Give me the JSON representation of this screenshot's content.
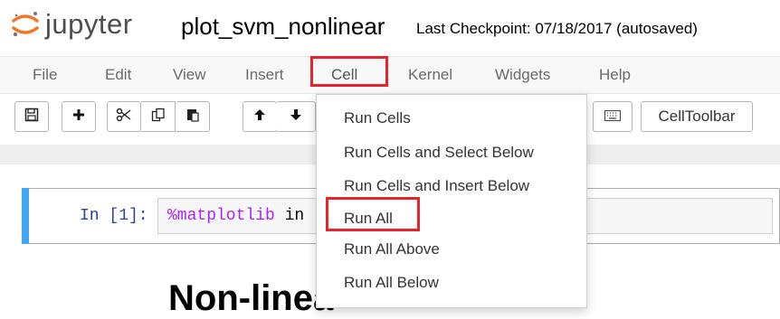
{
  "header": {
    "logo_text": "jupyter",
    "notebook_name": "plot_svm_nonlinear",
    "checkpoint_text": "Last Checkpoint: 07/18/2017 (autosaved)"
  },
  "menubar": {
    "items": [
      "File",
      "Edit",
      "View",
      "Insert",
      "Cell",
      "Kernel",
      "Widgets",
      "Help"
    ],
    "active": "Cell"
  },
  "toolbar": {
    "buttons": [
      {
        "name": "save-icon"
      },
      {
        "name": "add-cell-icon"
      },
      {
        "name": "cut-icon"
      },
      {
        "name": "copy-icon"
      },
      {
        "name": "paste-icon"
      },
      {
        "name": "move-up-icon"
      },
      {
        "name": "move-down-icon"
      },
      {
        "name": "keyboard-icon"
      }
    ],
    "celltoolbar_label": "CellToolbar"
  },
  "cell": {
    "prompt": "In [1]:",
    "code_magic": "%matplotlib",
    "code_rest": " in"
  },
  "heading": {
    "text": "Non-linea"
  },
  "cell_menu": {
    "items": [
      "Run Cells",
      "Run Cells and Select Below",
      "Run Cells and Insert Below",
      "Run All",
      "Run All Above",
      "Run All Below"
    ],
    "highlighted": "Run All"
  },
  "colors": {
    "highlight_box": "#e8232c",
    "cell_selected_bar": "#42a5f5",
    "prompt": "#303f9f",
    "magic": "#aa22ff"
  }
}
